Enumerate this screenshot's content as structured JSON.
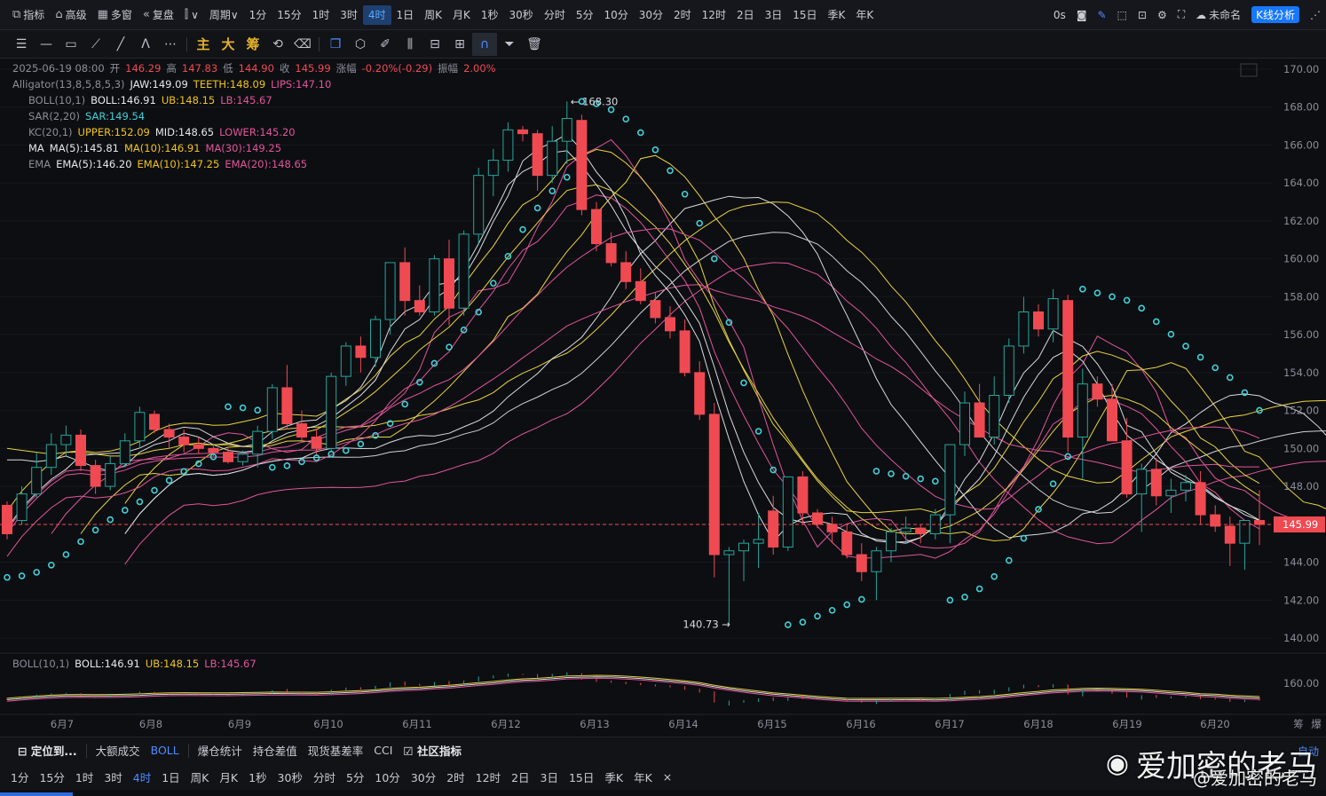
{
  "toolbar": {
    "items": [
      {
        "icon": "indicator-icon",
        "label": "指标"
      },
      {
        "icon": "advanced-icon",
        "label": "高级"
      },
      {
        "icon": "multi-window-icon",
        "label": "多窗"
      },
      {
        "icon": "replay-icon",
        "label": "复盘"
      },
      {
        "icon": "chart-type-icon",
        "label": "∨"
      },
      {
        "icon": "",
        "label": "周期∨"
      }
    ],
    "periods": [
      "1分",
      "15分",
      "1时",
      "3时",
      "4时",
      "1日",
      "周K",
      "月K",
      "1秒",
      "30秒",
      "分时",
      "5分",
      "10分",
      "30分",
      "2时",
      "12时",
      "2日",
      "3日",
      "15日",
      "季K",
      "年K"
    ],
    "active_period": "4时",
    "latency": "0s",
    "unnamed": "未命名",
    "kline_analysis": "K线分析"
  },
  "drawbar": {
    "text_buttons": [
      "主",
      "大",
      "筹"
    ]
  },
  "legend": {
    "candle": {
      "time": "2025-06-19 08:00",
      "open_label": "开",
      "open": "146.29",
      "high_label": "高",
      "high": "147.83",
      "low_label": "低",
      "low": "144.90",
      "close_label": "收",
      "close": "145.99",
      "chg_label": "涨幅",
      "chg": "-0.20%(-0.29)",
      "amp_label": "振幅",
      "amp": "2.00%"
    },
    "alligator": {
      "name": "Alligator(13,8,5,8,5,3)",
      "jaw": "JAW:149.09",
      "teeth": "TEETH:148.09",
      "lips": "LIPS:147.10"
    },
    "boll": {
      "name": "BOLL(10,1)",
      "mid": "BOLL:146.91",
      "ub": "UB:148.15",
      "lb": "LB:145.67"
    },
    "sar": {
      "name": "SAR(2,20)",
      "value": "SAR:149.54"
    },
    "kc": {
      "name": "KC(20,1)",
      "upper": "UPPER:152.09",
      "mid": "MID:148.65",
      "lower": "LOWER:145.20"
    },
    "ma": {
      "name": "MA",
      "ma5": "MA(5):145.81",
      "ma10": "MA(10):146.91",
      "ma30": "MA(30):149.25"
    },
    "ema": {
      "name": "EMA",
      "ema5": "EMA(5):146.20",
      "ema10": "EMA(10):147.25",
      "ema20": "EMA(20):148.65"
    }
  },
  "sub_legend": {
    "name": "BOLL(10,1)",
    "mid": "BOLL:146.91",
    "ub": "UB:148.15",
    "lb": "LB:145.67"
  },
  "indicators": {
    "locate": "定位到...",
    "items": [
      "大额成交",
      "BOLL",
      "爆仓统计",
      "持仓差值",
      "现货基差率",
      "CCI",
      "社区指标"
    ],
    "active": "BOLL"
  },
  "period_bar": [
    "1分",
    "15分",
    "1时",
    "3时",
    "4时",
    "1日",
    "周K",
    "月K",
    "1秒",
    "30秒",
    "分时",
    "5分",
    "10分",
    "30分",
    "2时",
    "12时",
    "2日",
    "3日",
    "15日",
    "季K",
    "年K",
    "×"
  ],
  "period_bar_active": "4时",
  "auto_label": "自动",
  "watermark": {
    "big": "爱加密的老马",
    "small": "@爱加密的老马"
  },
  "colors": {
    "up": "#26a69a",
    "down": "#ef4a52",
    "price_line": "#ef4a52",
    "sar": "#3fd1d6",
    "yellow": "#e8d33f",
    "pink": "#e0559a",
    "white": "#d9dbe0"
  },
  "chart_data": {
    "type": "candlestick",
    "y_axis_ticks": [
      "170.00",
      "168.00",
      "166.00",
      "164.00",
      "162.00",
      "160.00",
      "158.00",
      "156.00",
      "154.00",
      "152.00",
      "150.00",
      "148.00",
      "146.00",
      "144.00",
      "142.00",
      "140.00"
    ],
    "ylim": [
      139.5,
      170.5
    ],
    "x_axis_ticks": [
      "6月7",
      "6月8",
      "6月9",
      "6月10",
      "6月11",
      "6月12",
      "6月13",
      "6月14",
      "6月15",
      "6月16",
      "6月17",
      "6月18",
      "6月19",
      "6月20",
      "筹",
      "爆"
    ],
    "last_price": "145.99",
    "high_marker": "168.30",
    "low_marker": "140.73",
    "sub_axis_tick": "160.00",
    "candles": [
      [
        147.0,
        147.2,
        145.2,
        145.5
      ],
      [
        146.2,
        148.0,
        146.0,
        147.6
      ],
      [
        147.6,
        149.8,
        147.4,
        149.0
      ],
      [
        149.0,
        150.8,
        148.6,
        150.2
      ],
      [
        150.2,
        151.2,
        149.6,
        150.7
      ],
      [
        150.7,
        151.0,
        148.8,
        149.1
      ],
      [
        149.1,
        149.4,
        147.6,
        148.0
      ],
      [
        148.0,
        149.6,
        147.8,
        149.2
      ],
      [
        149.2,
        150.8,
        149.0,
        150.4
      ],
      [
        150.4,
        152.2,
        150.0,
        151.9
      ],
      [
        151.8,
        152.0,
        150.8,
        151.0
      ],
      [
        151.0,
        151.3,
        150.0,
        150.6
      ],
      [
        150.6,
        151.0,
        149.8,
        150.2
      ],
      [
        150.2,
        150.6,
        149.7,
        150.0
      ],
      [
        150.0,
        150.2,
        149.6,
        149.8
      ],
      [
        149.8,
        150.0,
        149.2,
        149.3
      ],
      [
        149.3,
        149.9,
        149.1,
        149.7
      ],
      [
        149.7,
        151.2,
        149.0,
        150.9
      ],
      [
        150.9,
        153.4,
        150.5,
        153.2
      ],
      [
        153.2,
        154.4,
        151.0,
        151.3
      ],
      [
        151.3,
        152.0,
        150.4,
        150.6
      ],
      [
        150.6,
        151.0,
        149.6,
        150.0
      ],
      [
        150.0,
        154.0,
        149.8,
        153.8
      ],
      [
        153.8,
        155.6,
        153.3,
        155.4
      ],
      [
        155.4,
        155.9,
        154.0,
        154.8
      ],
      [
        154.8,
        157.0,
        154.3,
        156.8
      ],
      [
        156.8,
        159.8,
        156.0,
        159.8
      ],
      [
        159.8,
        160.6,
        157.0,
        157.8
      ],
      [
        157.8,
        158.6,
        157.0,
        157.2
      ],
      [
        157.2,
        160.2,
        157.0,
        160.0
      ],
      [
        160.0,
        161.0,
        156.5,
        157.4
      ],
      [
        157.4,
        161.5,
        157.0,
        161.3
      ],
      [
        161.3,
        164.8,
        160.8,
        164.4
      ],
      [
        164.4,
        165.8,
        163.3,
        165.2
      ],
      [
        165.2,
        167.2,
        164.6,
        166.8
      ],
      [
        166.8,
        167.0,
        166.2,
        166.6
      ],
      [
        166.6,
        166.8,
        163.6,
        164.4
      ],
      [
        164.4,
        167.0,
        164.0,
        166.2
      ],
      [
        166.2,
        168.3,
        165.0,
        167.4
      ],
      [
        167.3,
        167.6,
        162.3,
        162.6
      ],
      [
        162.6,
        163.0,
        160.4,
        160.8
      ],
      [
        160.8,
        161.4,
        159.6,
        159.8
      ],
      [
        159.8,
        160.4,
        158.4,
        158.8
      ],
      [
        158.8,
        159.5,
        157.6,
        157.8
      ],
      [
        157.8,
        158.2,
        156.6,
        156.9
      ],
      [
        156.9,
        157.5,
        155.8,
        156.2
      ],
      [
        156.2,
        156.8,
        153.8,
        154.0
      ],
      [
        154.0,
        154.6,
        151.5,
        151.8
      ],
      [
        151.8,
        152.4,
        143.2,
        144.4
      ],
      [
        144.4,
        144.8,
        140.7,
        144.6
      ],
      [
        144.6,
        145.2,
        143.0,
        145.0
      ],
      [
        145.0,
        146.6,
        143.7,
        145.2
      ],
      [
        146.7,
        147.5,
        144.4,
        144.8
      ],
      [
        144.8,
        147.6,
        144.6,
        148.5
      ],
      [
        148.5,
        148.8,
        146.0,
        146.6
      ],
      [
        146.6,
        146.8,
        145.8,
        146.0
      ],
      [
        146.0,
        146.4,
        145.0,
        145.6
      ],
      [
        145.6,
        146.0,
        144.2,
        144.4
      ],
      [
        144.4,
        145.0,
        143.0,
        143.5
      ],
      [
        143.5,
        144.8,
        142.0,
        144.6
      ],
      [
        144.6,
        145.8,
        144.0,
        145.6
      ],
      [
        145.6,
        146.4,
        145.0,
        145.8
      ],
      [
        145.8,
        146.0,
        145.0,
        145.5
      ],
      [
        145.5,
        146.8,
        145.2,
        146.5
      ],
      [
        146.5,
        150.2,
        145.0,
        150.2
      ],
      [
        150.2,
        153.0,
        149.6,
        152.4
      ],
      [
        152.4,
        153.4,
        150.6,
        150.6
      ],
      [
        150.6,
        153.8,
        150.2,
        152.8
      ],
      [
        152.8,
        155.8,
        152.4,
        155.4
      ],
      [
        155.4,
        158.0,
        155.0,
        157.2
      ],
      [
        157.2,
        157.6,
        155.9,
        156.3
      ],
      [
        156.3,
        158.4,
        155.6,
        157.9
      ],
      [
        157.8,
        158.1,
        149.8,
        150.6
      ],
      [
        150.6,
        154.2,
        148.4,
        153.4
      ],
      [
        153.4,
        153.8,
        152.2,
        152.6
      ],
      [
        152.6,
        153.4,
        150.5,
        150.4
      ],
      [
        150.4,
        151.6,
        147.4,
        147.6
      ],
      [
        147.6,
        149.2,
        145.6,
        148.9
      ],
      [
        148.9,
        149.5,
        147.0,
        147.5
      ],
      [
        147.5,
        148.4,
        146.6,
        147.8
      ],
      [
        147.8,
        148.6,
        147.2,
        148.2
      ],
      [
        148.2,
        148.8,
        146.0,
        146.5
      ],
      [
        146.5,
        147.0,
        145.6,
        145.9
      ],
      [
        145.9,
        146.4,
        143.8,
        145.0
      ],
      [
        145.0,
        145.5,
        143.6,
        146.2
      ],
      [
        146.2,
        147.8,
        144.9,
        145.99
      ]
    ],
    "ma_values": [
      [
        149.4,
        149.4,
        149.3,
        149.4,
        149.6,
        149.3,
        149.0,
        148.8,
        149.1,
        149.8,
        150.2,
        150.4,
        150.8,
        150.6,
        150.2,
        149.9,
        149.8,
        149.9,
        150.4,
        150.8,
        151.0,
        151.2,
        151.6,
        152.2,
        152.8,
        153.6,
        155.1,
        156.3,
        156.8,
        157.9,
        158.4,
        159.4,
        160.8,
        162.3,
        163.9,
        164.6,
        165.0,
        165.6,
        165.7,
        164.9,
        163.9,
        162.8,
        161.5,
        160.5,
        159.6,
        158.9,
        157.8,
        156.6,
        154.3,
        151.8,
        149.8,
        148.2,
        146.9,
        146.3,
        146.1,
        146.2,
        146.0,
        145.6,
        145.4,
        145.2,
        145.1,
        145.0,
        145.3,
        145.9,
        146.8,
        147.6,
        148.4,
        149.6,
        151.2,
        152.7,
        153.9,
        154.8,
        155.2,
        154.6,
        153.4,
        151.9,
        150.7,
        150.1,
        149.4,
        148.9,
        148.5,
        148.0,
        147.4,
        147.0,
        146.5,
        146.2
      ],
      [
        150.0,
        149.9,
        149.8,
        149.7,
        149.8,
        149.8,
        149.7,
        149.6,
        149.6,
        149.7,
        149.9,
        150.0,
        150.2,
        150.2,
        150.2,
        150.2,
        150.1,
        150.1,
        150.3,
        150.6,
        150.8,
        151.0,
        151.4,
        151.9,
        152.4,
        153.0,
        153.7,
        154.4,
        155.2,
        155.8,
        156.4,
        157.2,
        158.1,
        159.1,
        160.1,
        161.0,
        161.9,
        162.8,
        163.6,
        163.8,
        163.9,
        163.6,
        163.1,
        162.4,
        161.7,
        160.8,
        159.7,
        158.6,
        157.2,
        155.6,
        154.2,
        152.9,
        151.6,
        150.5,
        149.4,
        148.4,
        147.6,
        146.9,
        146.3,
        145.8,
        145.6,
        145.5,
        145.5,
        145.7,
        145.9,
        146.3,
        146.7,
        147.3,
        148.0,
        148.9,
        149.9,
        150.9,
        151.8,
        152.3,
        152.7,
        152.8,
        152.6,
        152.3,
        151.8,
        151.1,
        150.5,
        149.9,
        149.3,
        148.6,
        148.0,
        147.5
      ]
    ]
  }
}
